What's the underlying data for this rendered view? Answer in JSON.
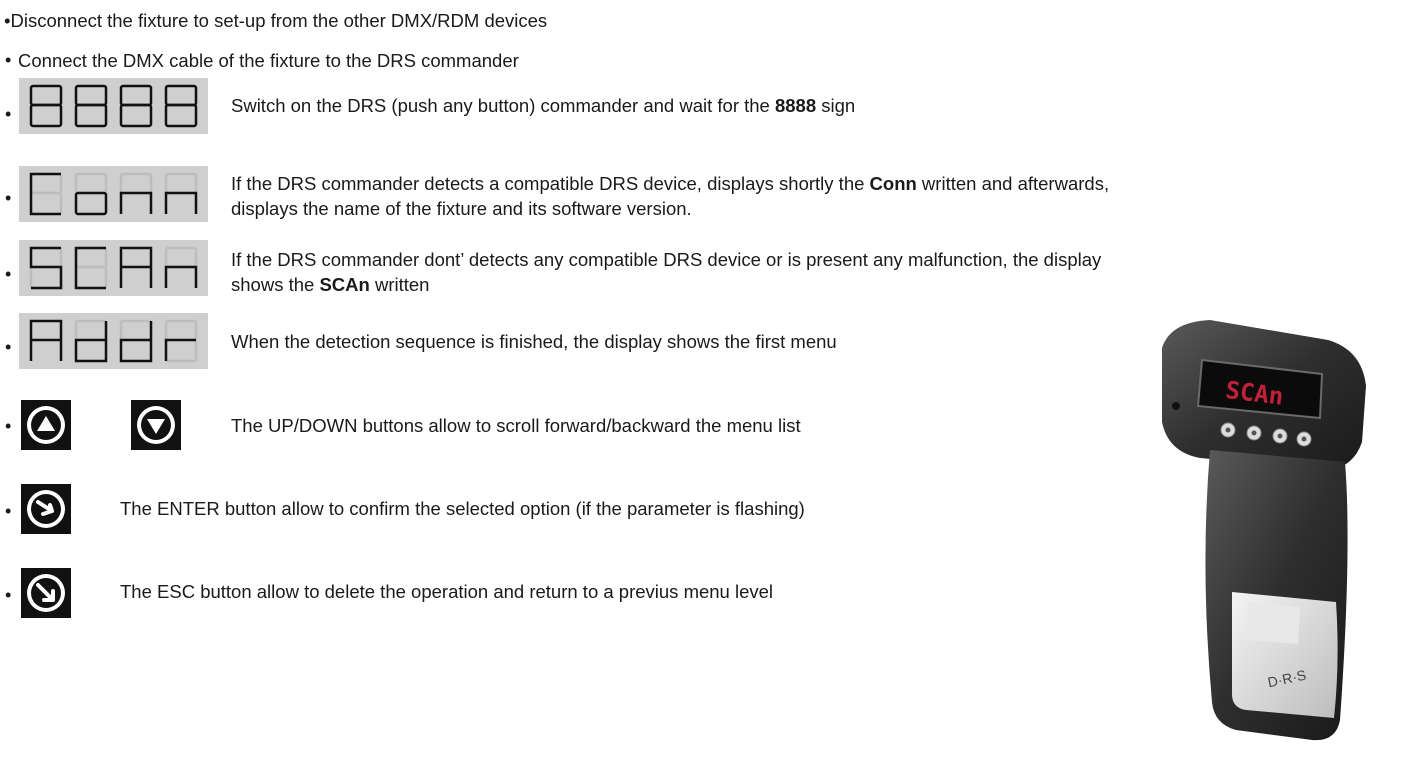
{
  "bullet": "•",
  "items": {
    "disconnect": "•Disconnect the fixture to set-up from the other DMX/RDM devices",
    "connect": "Connect the DMX cable of the fixture to the DRS commander",
    "switch_on": {
      "display": "8888",
      "pre": "Switch on the DRS (push any button) commander and wait for the ",
      "bold": "8888",
      "post": " sign"
    },
    "conn": {
      "display": "Conn",
      "pre": "If the DRS commander detects a compatible DRS device, displays shortly the ",
      "bold": "Conn",
      "post": " written and afterwards,",
      "line2": "displays the name of the fixture and its software version."
    },
    "scan": {
      "display": "SCAn",
      "line1": "If the DRS commander dont’ detects any compatible DRS device or is present any malfunction, the display",
      "pre": "shows the ",
      "bold": "SCAn",
      "post": " written"
    },
    "addr": {
      "display": "Addr",
      "text": "When the detection sequence is finished, the display shows the first menu"
    },
    "updown": {
      "icons": [
        "up-arrow-icon",
        "down-arrow-icon"
      ],
      "text": "The UP/DOWN buttons allow to scroll forward/backward the menu list"
    },
    "enter": {
      "icon": "enter-arrow-icon",
      "text": "The ENTER button allow to confirm the selected option (if the parameter is flashing)"
    },
    "esc": {
      "icon": "esc-arrow-icon",
      "text": "The ESC button allow to delete the operation and return to a previus menu level"
    }
  },
  "device": {
    "display": "SCAn",
    "brand": "D·R·S"
  }
}
